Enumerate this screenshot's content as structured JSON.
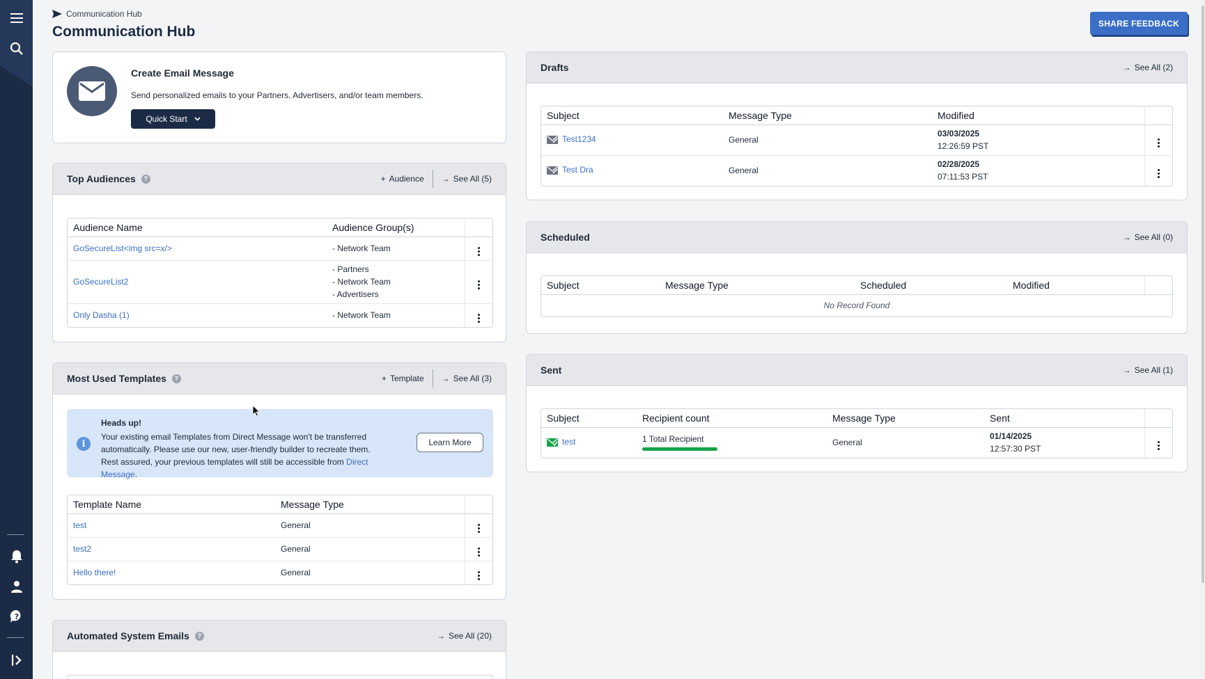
{
  "breadcrumb": "Communication Hub",
  "page_title": "Communication Hub",
  "feedback_label": "SHARE FEEDBACK",
  "create_email": {
    "title": "Create Email Message",
    "description": "Send personalized emails to your Partners, Advertisers, and/or team members.",
    "quick_start": "Quick Start"
  },
  "top_audiences": {
    "title": "Top Audiences",
    "add_label": "Audience",
    "see_all": "See All (5)",
    "columns": [
      "Audience Name",
      "Audience Group(s)"
    ],
    "rows": [
      {
        "name": "GoSecureList<img src=x/>",
        "groups": [
          "- Network Team"
        ]
      },
      {
        "name": "GoSecureList2",
        "groups": [
          "- Partners",
          "- Network Team",
          "- Advertisers"
        ]
      },
      {
        "name": "Only Dasha (1)",
        "groups": [
          "- Network Team"
        ]
      }
    ]
  },
  "templates": {
    "title": "Most Used Templates",
    "add_label": "Template",
    "see_all": "See All (3)",
    "notice_title": "Heads up!",
    "notice_text": "Your existing email Templates from Direct Message won't be transferred automatically. Please use our new, user-friendly builder to recreate them. Rest assured, your previous templates will still be accessible from",
    "notice_link": "Direct Message",
    "notice_end": ".",
    "learn_more": "Learn More",
    "columns": [
      "Template Name",
      "Message Type"
    ],
    "rows": [
      {
        "name": "test",
        "type": "General"
      },
      {
        "name": "test2",
        "type": "General"
      },
      {
        "name": "Hello there!",
        "type": "General"
      }
    ]
  },
  "automated": {
    "title": "Automated System Emails",
    "see_all": "See All (20)"
  },
  "drafts": {
    "title": "Drafts",
    "see_all": "See All (2)",
    "columns": [
      "Subject",
      "Message Type",
      "Modified"
    ],
    "rows": [
      {
        "subject": "Test1234",
        "type": "General",
        "date": "03/03/2025",
        "time": "12:26:59 PST"
      },
      {
        "subject": "Test Dra",
        "type": "General",
        "date": "02/28/2025",
        "time": "07:11:53 PST"
      }
    ]
  },
  "scheduled": {
    "title": "Scheduled",
    "see_all": "See All (0)",
    "columns": [
      "Subject",
      "Message Type",
      "Scheduled",
      "Modified"
    ],
    "empty": "No Record Found"
  },
  "sent": {
    "title": "Sent",
    "see_all": "See All (1)",
    "columns": [
      "Subject",
      "Recipient count",
      "Message Type",
      "Sent"
    ],
    "rows": [
      {
        "subject": "test",
        "recipients": "1 Total Recipient",
        "progress": 1.0,
        "type": "General",
        "date": "01/14/2025",
        "time": "12:57:30 PST"
      }
    ]
  },
  "colors": {
    "navy": "#1c2b45",
    "link": "#3b6fc7",
    "success": "#16a34a",
    "notice_bg": "#d7e6f8"
  }
}
